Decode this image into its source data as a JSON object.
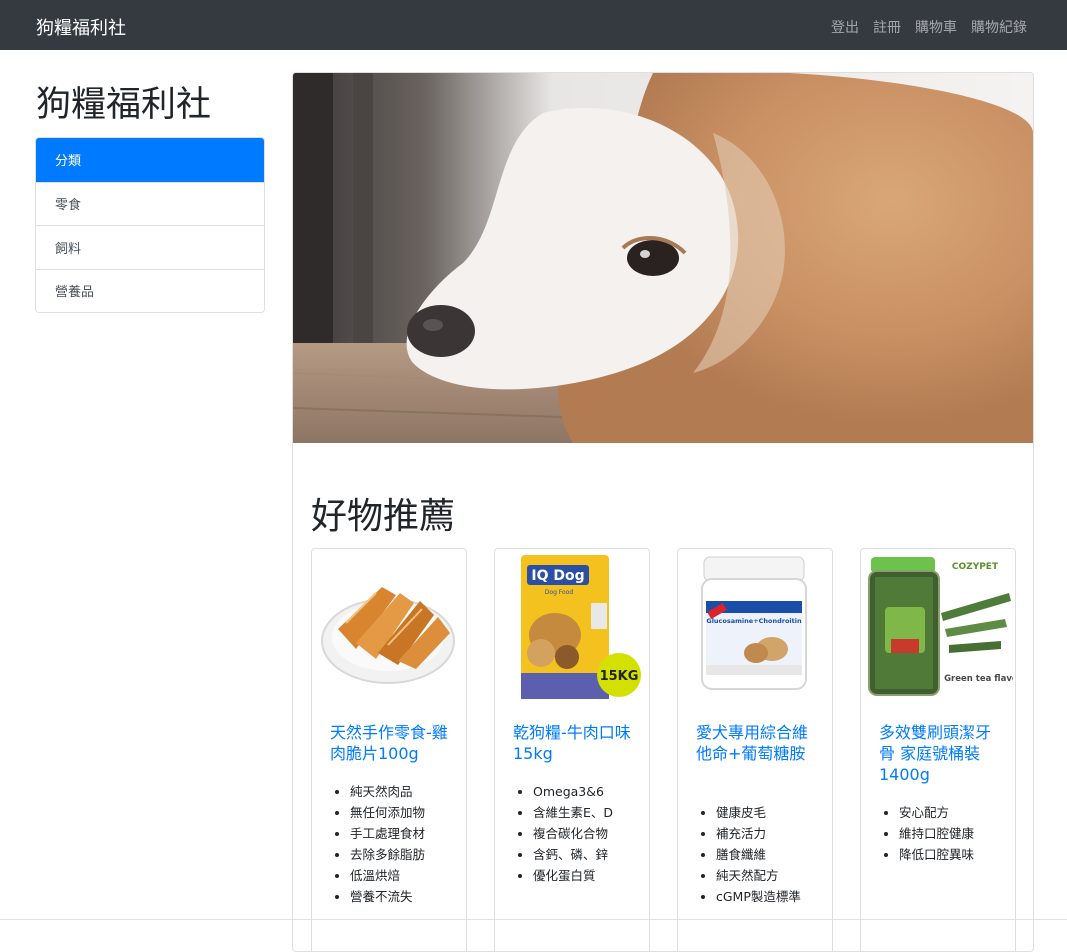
{
  "navbar": {
    "brand": "狗糧福利社",
    "links": [
      "登出",
      "註冊",
      "購物車",
      "購物紀錄"
    ]
  },
  "site_title": "狗糧福利社",
  "sidebar": {
    "items": [
      {
        "label": "分類",
        "active": true
      },
      {
        "label": "零食",
        "active": false
      },
      {
        "label": "飼料",
        "active": false
      },
      {
        "label": "營養品",
        "active": false
      }
    ]
  },
  "section_title": "好物推薦",
  "products": [
    {
      "title": "天然手作零食-雞肉脆片100g",
      "features": [
        "純天然肉品",
        "無任何添加物",
        "手工處理食材",
        "去除多餘脂肪",
        "低溫烘焙",
        "營養不流失"
      ]
    },
    {
      "title": "乾狗糧-牛肉口味15kg",
      "features": [
        "Omega3&6",
        "含維生素E、D",
        "複合碳化合物",
        "含鈣、磷、鋅",
        "優化蛋白質"
      ],
      "image_text": {
        "brand": "IQ Dog",
        "sub": "Dog Food",
        "weight": "15KG"
      }
    },
    {
      "title": "愛犬專用綜合維他命+葡萄糖胺",
      "features": [
        "健康皮毛",
        "補充活力",
        "膳食纖維",
        "純天然配方",
        "cGMP製造標準"
      ],
      "image_text": {
        "label": "Glucosamine+Chondroitin"
      }
    },
    {
      "title": "多效雙刷頭潔牙骨 家庭號桶裝 1400g",
      "features": [
        "安心配方",
        "維持口腔健康",
        "降低口腔異味"
      ],
      "image_text": {
        "brand": "COZYPET",
        "flavor": "Green tea flavor"
      }
    }
  ],
  "colors": {
    "navbar_bg": "#343a40",
    "accent": "#007bff",
    "nav_link": "rgba(255,255,255,0.55)"
  }
}
